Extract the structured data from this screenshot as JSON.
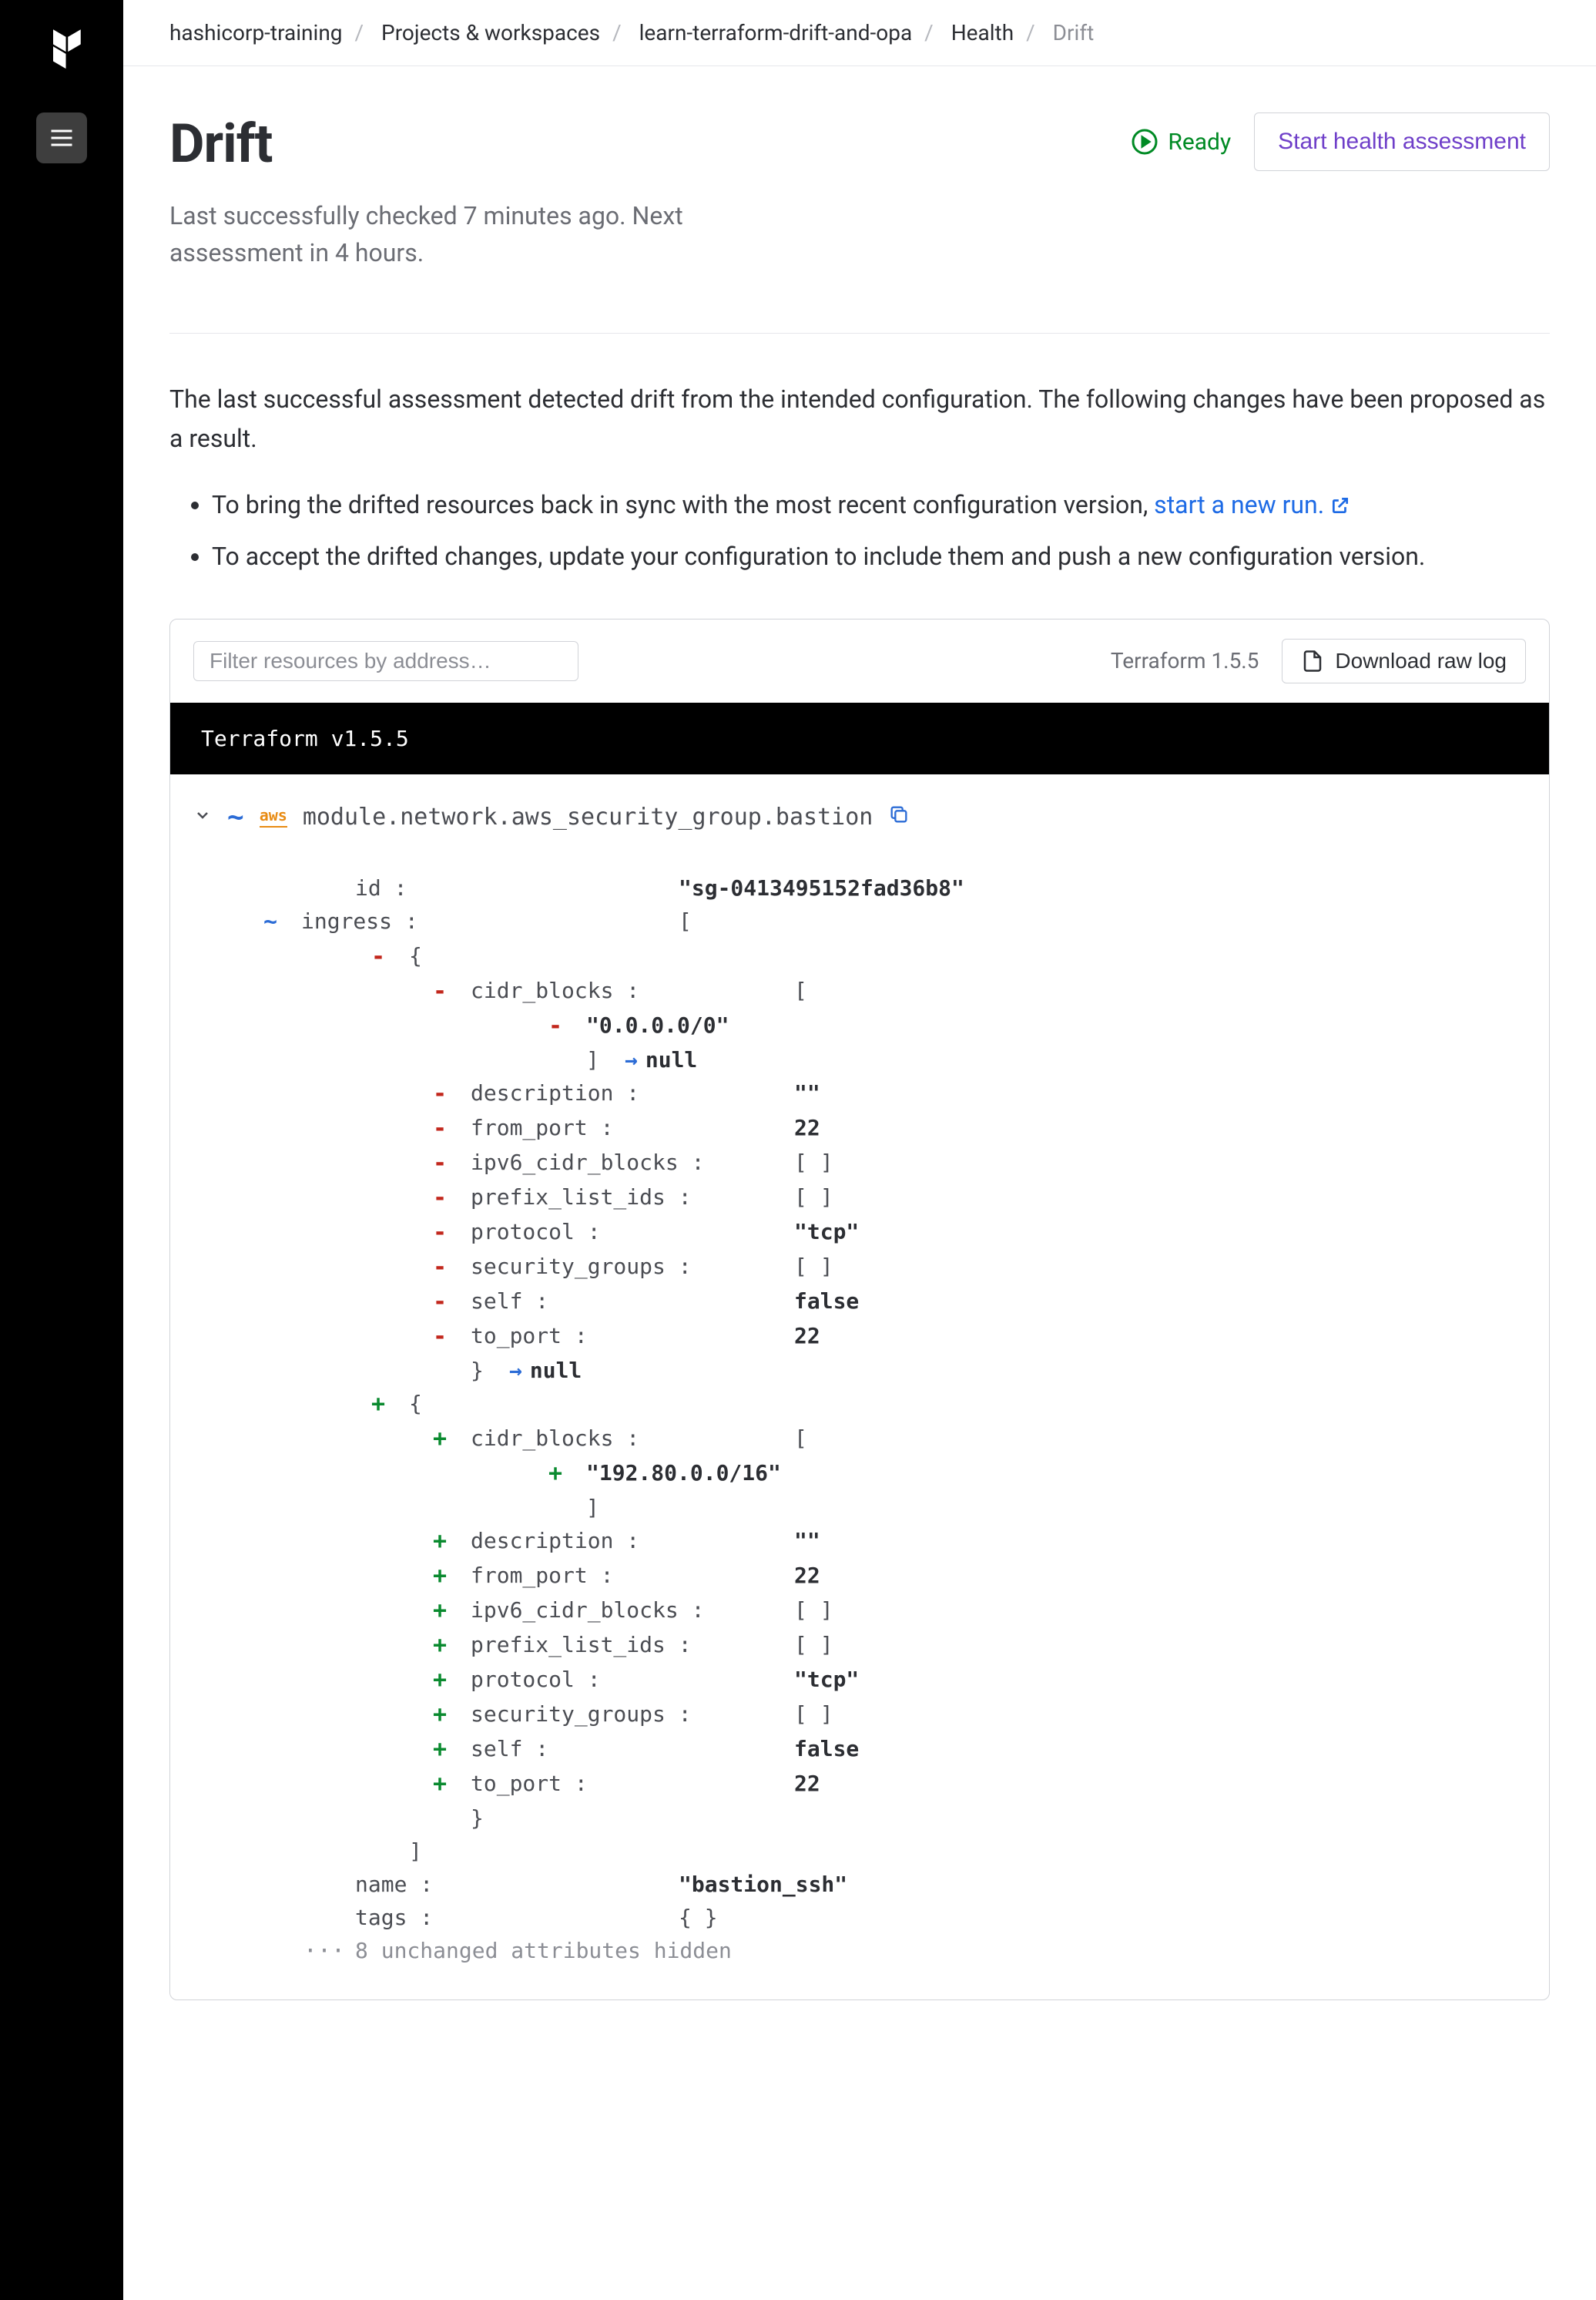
{
  "breadcrumbs": [
    "hashicorp-training",
    "Projects & workspaces",
    "learn-terraform-drift-and-opa",
    "Health",
    "Drift"
  ],
  "page": {
    "title": "Drift",
    "subtitle": "Last successfully checked 7 minutes ago. Next assessment in 4 hours.",
    "ready_label": "Ready",
    "start_button": "Start health assessment",
    "intro": "The last successful assessment detected drift from the intended configuration. The following changes have been proposed as a result.",
    "bullet1_pre": "To bring the drifted resources back in sync with the most recent configuration version, ",
    "bullet1_link": "start a new run.",
    "bullet2": "To accept the drifted changes, update your configuration to include them and push a new configuration version."
  },
  "panel": {
    "filter_placeholder": "Filter resources by address…",
    "tf_version_short": "Terraform 1.5.5",
    "download_label": "Download raw log",
    "terminal_line": "Terraform v1.5.5",
    "aws_label": "aws",
    "resource_address": "module.network.aws_security_group.bastion",
    "hidden_note": "8 unchanged attributes hidden"
  },
  "diff": {
    "id_key": "id :",
    "id_val": "\"sg-0413495152fad36b8\"",
    "ingress_key": "ingress :",
    "open_bracket": "[",
    "open_brace": "{",
    "cidr_key": "cidr_blocks :",
    "old_cidr": "\"0.0.0.0/0\"",
    "close_bracket_arrow_null": "]",
    "arrow_null": "null",
    "desc_key": "description :",
    "desc_val": "\"\"",
    "from_port_key": "from_port :",
    "port22": "22",
    "ipv6_key": "ipv6_cidr_blocks :",
    "empty_arr": "[   ]",
    "prefix_key": "prefix_list_ids :",
    "protocol_key": "protocol :",
    "protocol_val": "\"tcp\"",
    "sg_key": "security_groups :",
    "self_key": "self :",
    "false_val": "false",
    "to_port_key": "to_port :",
    "close_brace": "}",
    "new_cidr": "\"192.80.0.0/16\"",
    "close_bracket": "]",
    "name_key": "name :",
    "name_val": "\"bastion_ssh\"",
    "tags_key": "tags :",
    "tags_val": "{   }"
  }
}
